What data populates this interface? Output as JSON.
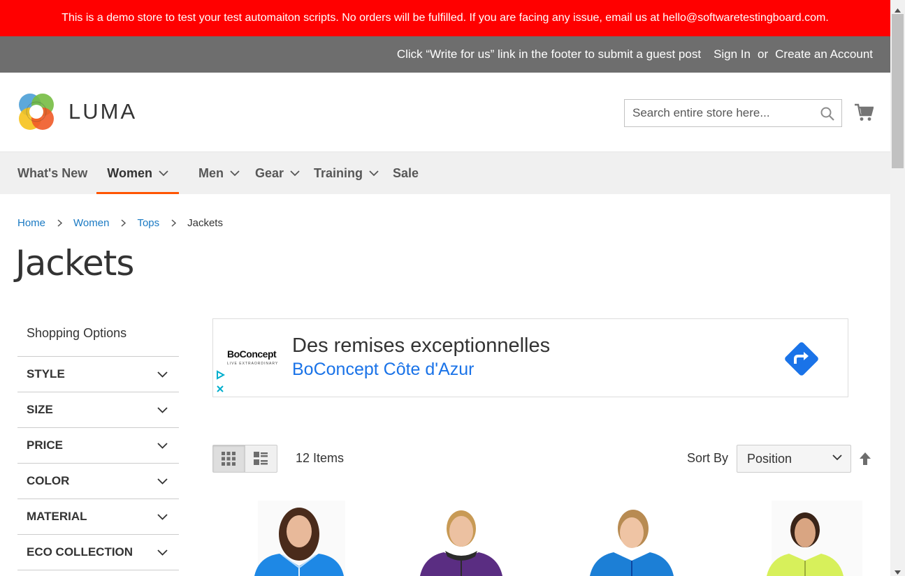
{
  "demo_banner": "This is a demo store to test your test automaiton scripts. No orders will be fulfilled. If you are facing any issue, email us at hello@softwaretestingboard.com.",
  "panel": {
    "guest_post": "Click “Write for us” link in the footer to submit a guest post",
    "sign_in": "Sign In",
    "or": "or",
    "create_account": "Create an Account"
  },
  "logo_text": "LUMA",
  "search": {
    "placeholder": "Search entire store here..."
  },
  "nav": [
    {
      "label": "What's New"
    },
    {
      "label": "Women"
    },
    {
      "label": "Men"
    },
    {
      "label": "Gear"
    },
    {
      "label": "Training"
    },
    {
      "label": "Sale"
    }
  ],
  "breadcrumbs": [
    "Home",
    "Women",
    "Tops",
    "Jackets"
  ],
  "page_title": "Jackets",
  "sidebar": {
    "title": "Shopping Options",
    "filters": [
      "STYLE",
      "SIZE",
      "PRICE",
      "COLOR",
      "MATERIAL",
      "ECO COLLECTION"
    ]
  },
  "ad": {
    "brand": "BoConcept",
    "brand_tagline": "LIVE EXTRAORDINARY",
    "headline": "Des remises exceptionnelles",
    "subline": "BoConcept Côte d'Azur"
  },
  "toolbar": {
    "amount": "12 Items",
    "sort_label": "Sort By",
    "sort_value": "Position"
  },
  "products": [
    {
      "jacket_color": "#1e88e5"
    },
    {
      "jacket_color": "#5a2d82"
    },
    {
      "jacket_color": "#1c7fd6"
    },
    {
      "jacket_color": "#d7f05b"
    }
  ],
  "colors": {
    "banner": "#ff0000",
    "panel": "#6e6e6e",
    "nav_active_underline": "#ff5501",
    "link": "#1979c3",
    "ad_link": "#1a73e8"
  }
}
